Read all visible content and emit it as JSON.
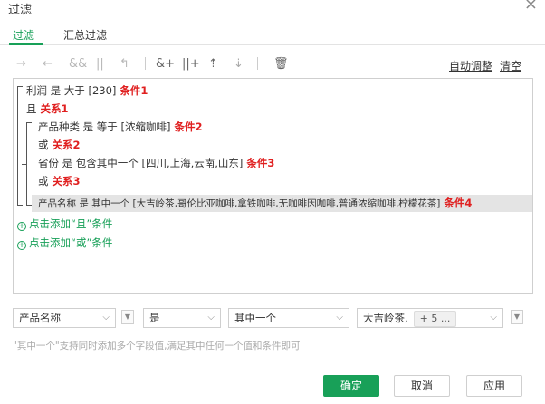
{
  "dialog": {
    "title": "过滤",
    "close": "×"
  },
  "tabs": [
    {
      "label": "过滤",
      "active": true
    },
    {
      "label": "汇总过滤",
      "active": false
    }
  ],
  "toolbar": {
    "icons": [
      "arrow-right-icon",
      "arrow-left-icon",
      "and-icon",
      "or-icon",
      "return-icon",
      "add-and-icon",
      "add-or-icon",
      "move-up-icon",
      "move-down-icon",
      "delete-icon"
    ],
    "auto_adjust": "自动调整",
    "clear": "清空"
  },
  "conditions": {
    "row1": {
      "text": "利润 是 大于 [230]",
      "note": "条件1"
    },
    "row2": {
      "text": "且",
      "note": "关系1"
    },
    "row3": {
      "text": "产品种类 是 等于 [浓缩咖啡]",
      "note": "条件2"
    },
    "row4": {
      "text": "或",
      "note": "关系2"
    },
    "row5": {
      "text": "省份 是 包含其中一个 [四川,上海,云南,山东]",
      "note": "条件3"
    },
    "row6": {
      "text": "或",
      "note": "关系3"
    },
    "row7": {
      "text": "产品名称 是 其中一个 [大吉岭茶,哥伦比亚咖啡,拿铁咖啡,无咖啡因咖啡,普通浓缩咖啡,柠檬花茶]",
      "note": "条件4"
    }
  },
  "add_and": "点击添加“且”条件",
  "add_or": "点击添加“或”条件",
  "editor": {
    "field": "产品名称",
    "operator": "是",
    "match": "其中一个",
    "value": "大吉岭茶,",
    "more": "+ 5 ..."
  },
  "hint": "\"其中一个\"支持同时添加多个字段值,满足其中任何一个值和条件即可",
  "buttons": {
    "ok": "确定",
    "cancel": "取消",
    "apply": "应用"
  },
  "colors": {
    "accent": "#18a058",
    "annotation": "#e02020"
  }
}
